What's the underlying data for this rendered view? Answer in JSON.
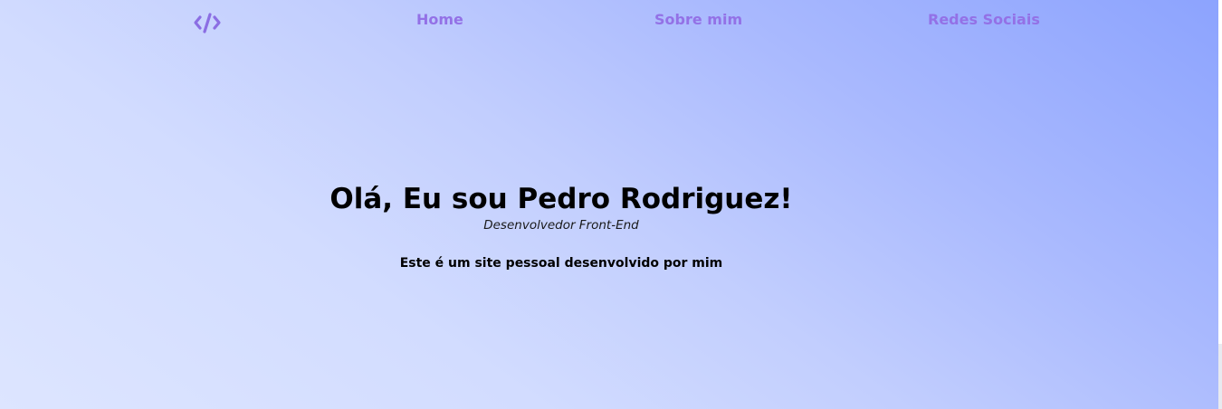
{
  "theme": {
    "accent": "#8b6ee3",
    "link_color": "#9371e6"
  },
  "nav": {
    "logo_icon": "code-icon",
    "items": [
      {
        "label": "Home"
      },
      {
        "label": "Sobre mim"
      },
      {
        "label": "Redes Sociais"
      }
    ]
  },
  "hero": {
    "title": "Olá, Eu sou Pedro Rodriguez!",
    "subtitle": "Desenvolvedor Front-End",
    "description": "Este é um site pessoal desenvolvido por mim"
  }
}
